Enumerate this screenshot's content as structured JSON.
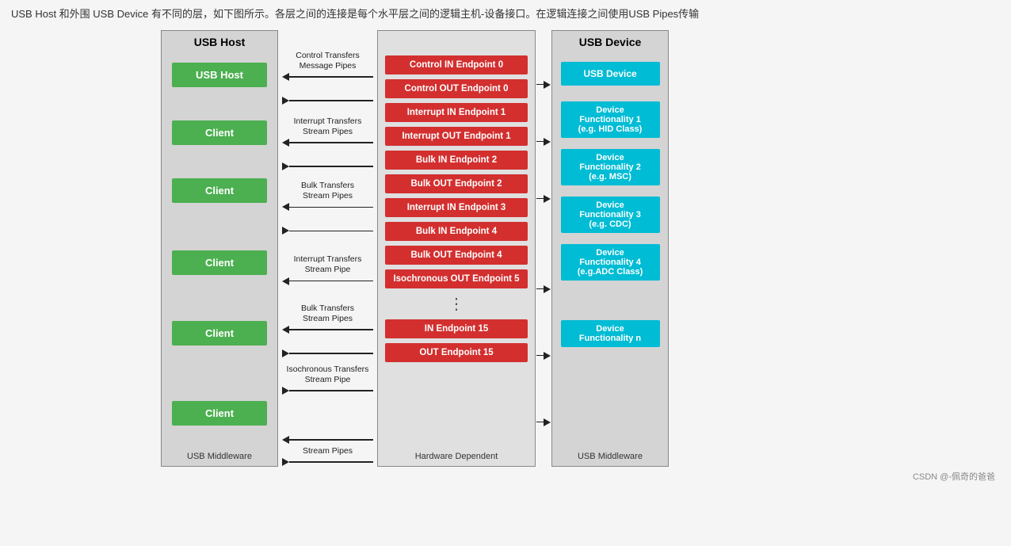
{
  "top_text": "USB Host 和外围 USB Device 有不同的层，如下图所示。各层之间的连接是每个水平层之间的逻辑主机-设备接口。在逻辑连接之间使用USB Pipes传输",
  "diagram": {
    "host_title": "USB Host",
    "device_title": "USB Device",
    "host_footer": "USB Middleware",
    "endpoints_footer": "Hardware Dependent",
    "device_footer": "USB Middleware",
    "host_boxes": [
      "USB Host",
      "Client",
      "Client",
      "Client",
      "Client",
      "Client"
    ],
    "device_cyan_boxes": [
      "USB Device",
      "Device\nFunctionality 1\n(e.g. HID Class)",
      "Device\nFunctionality 2\n(e.g. MSC)",
      "Device\nFunctionality 3\n(e.g. CDC)",
      "Device\nFunctionality 4\n(e.g.ADC Class)",
      "Device\nFunctionality n"
    ],
    "endpoints": [
      "Control IN Endpoint 0",
      "Control OUT Endpoint 0",
      "Interrupt IN Endpoint 1",
      "Interrupt OUT Endpoint 1",
      "Bulk IN Endpoint 2",
      "Bulk OUT Endpoint 2",
      "Interrupt IN Endpoint 3",
      "Bulk IN Endpoint 4",
      "Bulk OUT Endpoint 4",
      "Isochronous OUT Endpoint 5",
      "IN Endpoint 15",
      "OUT Endpoint 15"
    ],
    "arrow_groups": [
      {
        "text1": "Control Transfers",
        "text2": "Message Pipes"
      },
      {
        "text1": "Interrupt Transfers",
        "text2": "Stream Pipes"
      },
      {
        "text1": "Bulk Transfers",
        "text2": "Stream Pipes"
      },
      {
        "text1": "Interrupt Transfers",
        "text2": "Stream Pipe"
      },
      {
        "text1": "Bulk Transfers",
        "text2": "Stream Pipes"
      },
      {
        "text1": "Isochronous Transfers",
        "text2": "Stream Pipe"
      },
      {
        "text1": "Stream Pipes",
        "text2": ""
      }
    ]
  },
  "watermark": "CSDN @-佩奇的爸爸"
}
